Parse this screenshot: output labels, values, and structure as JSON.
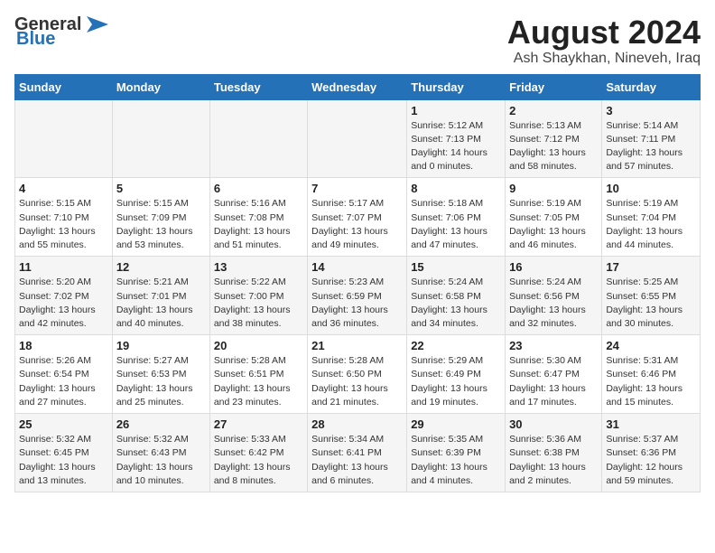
{
  "header": {
    "logo_line1": "General",
    "logo_line2": "Blue",
    "title": "August 2024",
    "subtitle": "Ash Shaykhan, Nineveh, Iraq"
  },
  "days_of_week": [
    "Sunday",
    "Monday",
    "Tuesday",
    "Wednesday",
    "Thursday",
    "Friday",
    "Saturday"
  ],
  "weeks": [
    [
      {
        "num": "",
        "info": ""
      },
      {
        "num": "",
        "info": ""
      },
      {
        "num": "",
        "info": ""
      },
      {
        "num": "",
        "info": ""
      },
      {
        "num": "1",
        "info": "Sunrise: 5:12 AM\nSunset: 7:13 PM\nDaylight: 14 hours\nand 0 minutes."
      },
      {
        "num": "2",
        "info": "Sunrise: 5:13 AM\nSunset: 7:12 PM\nDaylight: 13 hours\nand 58 minutes."
      },
      {
        "num": "3",
        "info": "Sunrise: 5:14 AM\nSunset: 7:11 PM\nDaylight: 13 hours\nand 57 minutes."
      }
    ],
    [
      {
        "num": "4",
        "info": "Sunrise: 5:15 AM\nSunset: 7:10 PM\nDaylight: 13 hours\nand 55 minutes."
      },
      {
        "num": "5",
        "info": "Sunrise: 5:15 AM\nSunset: 7:09 PM\nDaylight: 13 hours\nand 53 minutes."
      },
      {
        "num": "6",
        "info": "Sunrise: 5:16 AM\nSunset: 7:08 PM\nDaylight: 13 hours\nand 51 minutes."
      },
      {
        "num": "7",
        "info": "Sunrise: 5:17 AM\nSunset: 7:07 PM\nDaylight: 13 hours\nand 49 minutes."
      },
      {
        "num": "8",
        "info": "Sunrise: 5:18 AM\nSunset: 7:06 PM\nDaylight: 13 hours\nand 47 minutes."
      },
      {
        "num": "9",
        "info": "Sunrise: 5:19 AM\nSunset: 7:05 PM\nDaylight: 13 hours\nand 46 minutes."
      },
      {
        "num": "10",
        "info": "Sunrise: 5:19 AM\nSunset: 7:04 PM\nDaylight: 13 hours\nand 44 minutes."
      }
    ],
    [
      {
        "num": "11",
        "info": "Sunrise: 5:20 AM\nSunset: 7:02 PM\nDaylight: 13 hours\nand 42 minutes."
      },
      {
        "num": "12",
        "info": "Sunrise: 5:21 AM\nSunset: 7:01 PM\nDaylight: 13 hours\nand 40 minutes."
      },
      {
        "num": "13",
        "info": "Sunrise: 5:22 AM\nSunset: 7:00 PM\nDaylight: 13 hours\nand 38 minutes."
      },
      {
        "num": "14",
        "info": "Sunrise: 5:23 AM\nSunset: 6:59 PM\nDaylight: 13 hours\nand 36 minutes."
      },
      {
        "num": "15",
        "info": "Sunrise: 5:24 AM\nSunset: 6:58 PM\nDaylight: 13 hours\nand 34 minutes."
      },
      {
        "num": "16",
        "info": "Sunrise: 5:24 AM\nSunset: 6:56 PM\nDaylight: 13 hours\nand 32 minutes."
      },
      {
        "num": "17",
        "info": "Sunrise: 5:25 AM\nSunset: 6:55 PM\nDaylight: 13 hours\nand 30 minutes."
      }
    ],
    [
      {
        "num": "18",
        "info": "Sunrise: 5:26 AM\nSunset: 6:54 PM\nDaylight: 13 hours\nand 27 minutes."
      },
      {
        "num": "19",
        "info": "Sunrise: 5:27 AM\nSunset: 6:53 PM\nDaylight: 13 hours\nand 25 minutes."
      },
      {
        "num": "20",
        "info": "Sunrise: 5:28 AM\nSunset: 6:51 PM\nDaylight: 13 hours\nand 23 minutes."
      },
      {
        "num": "21",
        "info": "Sunrise: 5:28 AM\nSunset: 6:50 PM\nDaylight: 13 hours\nand 21 minutes."
      },
      {
        "num": "22",
        "info": "Sunrise: 5:29 AM\nSunset: 6:49 PM\nDaylight: 13 hours\nand 19 minutes."
      },
      {
        "num": "23",
        "info": "Sunrise: 5:30 AM\nSunset: 6:47 PM\nDaylight: 13 hours\nand 17 minutes."
      },
      {
        "num": "24",
        "info": "Sunrise: 5:31 AM\nSunset: 6:46 PM\nDaylight: 13 hours\nand 15 minutes."
      }
    ],
    [
      {
        "num": "25",
        "info": "Sunrise: 5:32 AM\nSunset: 6:45 PM\nDaylight: 13 hours\nand 13 minutes."
      },
      {
        "num": "26",
        "info": "Sunrise: 5:32 AM\nSunset: 6:43 PM\nDaylight: 13 hours\nand 10 minutes."
      },
      {
        "num": "27",
        "info": "Sunrise: 5:33 AM\nSunset: 6:42 PM\nDaylight: 13 hours\nand 8 minutes."
      },
      {
        "num": "28",
        "info": "Sunrise: 5:34 AM\nSunset: 6:41 PM\nDaylight: 13 hours\nand 6 minutes."
      },
      {
        "num": "29",
        "info": "Sunrise: 5:35 AM\nSunset: 6:39 PM\nDaylight: 13 hours\nand 4 minutes."
      },
      {
        "num": "30",
        "info": "Sunrise: 5:36 AM\nSunset: 6:38 PM\nDaylight: 13 hours\nand 2 minutes."
      },
      {
        "num": "31",
        "info": "Sunrise: 5:37 AM\nSunset: 6:36 PM\nDaylight: 12 hours\nand 59 minutes."
      }
    ]
  ]
}
